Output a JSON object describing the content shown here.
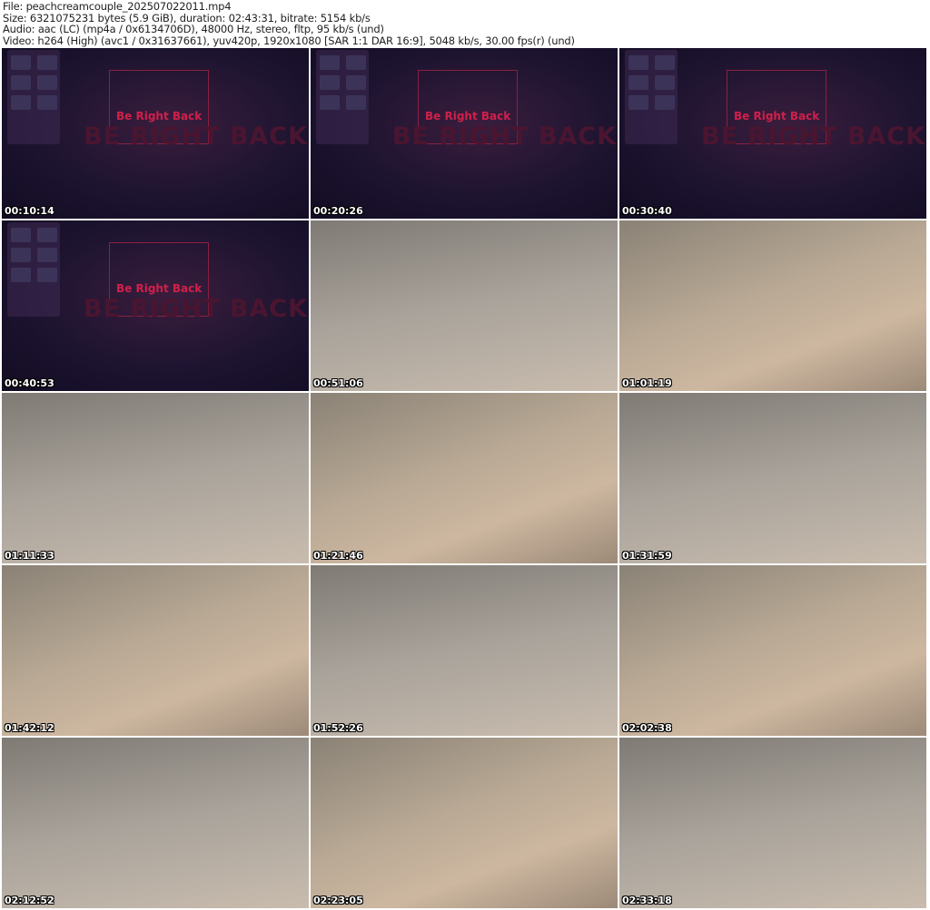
{
  "header": {
    "file": "File: peachcreamcouple_202507022011.mp4",
    "size": "Size: 6321075231 bytes (5.9 GiB), duration: 02:43:31, bitrate: 5154 kb/s",
    "audio": "Audio: aac (LC) (mp4a / 0x6134706D), 48000 Hz, stereo, fltp, 95 kb/s (und)",
    "video": "Video: h264 (High) (avc1 / 0x31637661), yuv420p, 1920x1080 [SAR 1:1 DAR 16:9], 5048 kb/s, 30.00 fps(r) (und)"
  },
  "brb": {
    "small": "Be Right Back",
    "big": "BE RIGHT BACK"
  },
  "thumbnails": [
    {
      "timestamp": "00:10:14"
    },
    {
      "timestamp": "00:20:26"
    },
    {
      "timestamp": "00:30:40"
    },
    {
      "timestamp": "00:40:53"
    },
    {
      "timestamp": "00:51:06"
    },
    {
      "timestamp": "01:01:19"
    },
    {
      "timestamp": "01:11:33"
    },
    {
      "timestamp": "01:21:46"
    },
    {
      "timestamp": "01:31:59"
    },
    {
      "timestamp": "01:42:12"
    },
    {
      "timestamp": "01:52:26"
    },
    {
      "timestamp": "02:02:38"
    },
    {
      "timestamp": "02:12:52"
    },
    {
      "timestamp": "02:23:05"
    },
    {
      "timestamp": "02:33:18"
    }
  ]
}
